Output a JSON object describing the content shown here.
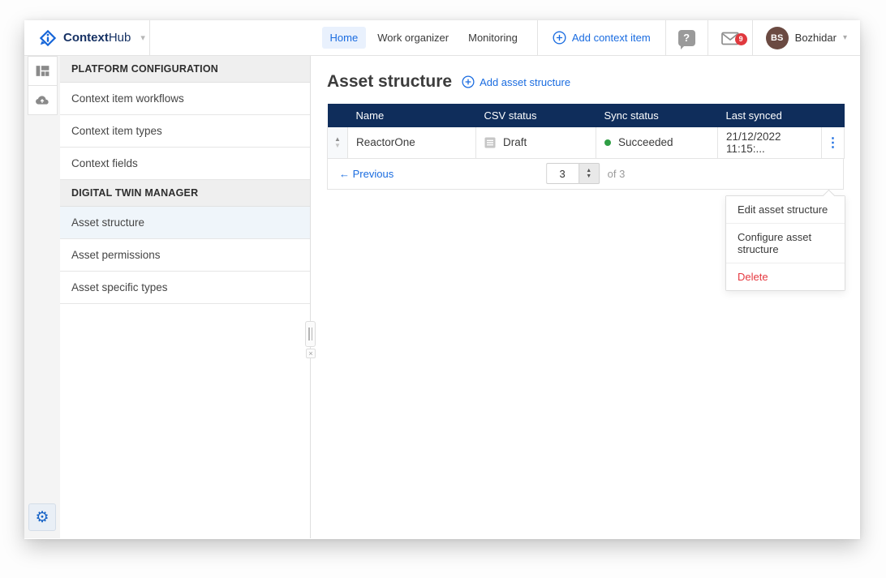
{
  "topbar": {
    "logo": {
      "bold": "Context",
      "light": "Hub"
    },
    "nav": [
      {
        "label": "Home",
        "active": true
      },
      {
        "label": "Work organizer",
        "active": false
      },
      {
        "label": "Monitoring",
        "active": false
      }
    ],
    "add_label": "Add context item",
    "help_glyph": "?",
    "mail_badge": "9",
    "user": {
      "initials": "BS",
      "name": "Bozhidar"
    }
  },
  "sidebar": {
    "sections": [
      {
        "title": "PLATFORM CONFIGURATION",
        "items": [
          {
            "label": "Context item workflows"
          },
          {
            "label": "Context item types"
          },
          {
            "label": "Context fields"
          }
        ]
      },
      {
        "title": "DIGITAL TWIN MANAGER",
        "items": [
          {
            "label": "Asset structure",
            "selected": true
          },
          {
            "label": "Asset permissions"
          },
          {
            "label": "Asset specific types"
          }
        ]
      }
    ]
  },
  "main": {
    "title": "Asset structure",
    "add_label": "Add asset structure",
    "table": {
      "columns": [
        "Name",
        "CSV status",
        "Sync status",
        "Last synced"
      ],
      "rows": [
        {
          "name": "ReactorOne",
          "csv_status": "Draft",
          "sync_status": "Succeeded",
          "last_synced": "21/12/2022 11:15:..."
        }
      ]
    },
    "pagination": {
      "prev": "← Previous",
      "page": "3",
      "of": "of 3"
    },
    "context_menu": [
      {
        "label": "Edit asset structure"
      },
      {
        "label": "Configure asset structure"
      },
      {
        "label": "Delete",
        "danger": true
      }
    ]
  },
  "icons": {
    "logo": "diamond-i-bubble",
    "nav_add": "plus-circle",
    "help": "question-bubble",
    "mail": "envelope",
    "rail_top": "dashboard-layout",
    "rail_second": "cloud-upload",
    "rail_bottom": "gear",
    "csv_status": "document-lines",
    "sync_status": "green-dot",
    "row_actions": "kebab-vertical"
  },
  "glyphs": {
    "chevron_down": "▾",
    "sort_up": "▲",
    "sort_down": "▼",
    "step_up": "▲",
    "step_down": "▼",
    "kebab": "⋮",
    "gear": "⚙",
    "close": "×"
  },
  "colors": {
    "accent_blue": "#1a6ce0",
    "brand_blue": "#1565d8",
    "table_header_navy": "#0f2d5b",
    "success_green": "#2f9e44",
    "danger_red": "#e5383f",
    "badge_red": "#e0393e",
    "avatar_brown": "#6b4a42",
    "nav_active_bg": "#e9f1fd",
    "selected_item_bg": "#eff5fa"
  }
}
